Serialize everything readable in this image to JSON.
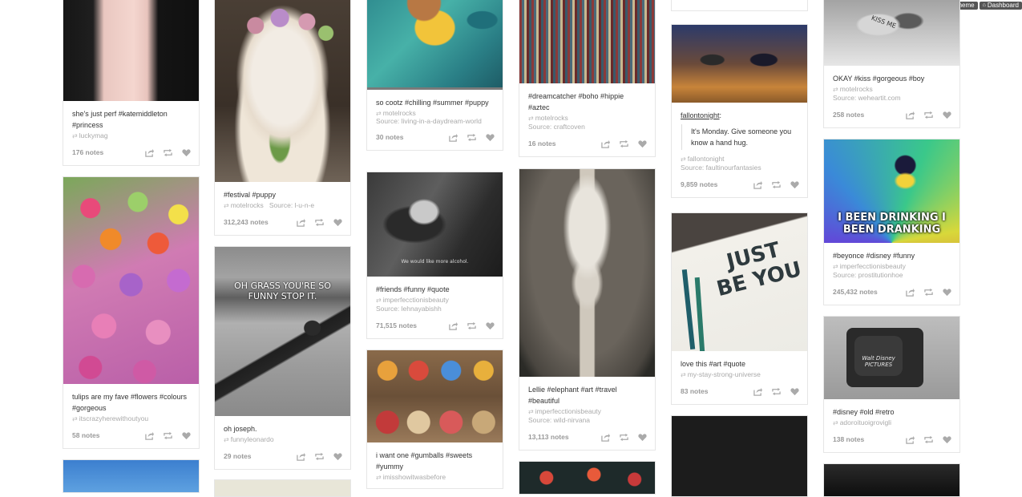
{
  "topbar": {
    "edit_label": "Edit theme",
    "dashboard_label": "Dashboard"
  },
  "colors": {
    "bg": "#ffffff",
    "card_border": "#e6e6e6",
    "muted": "#aaaaaa",
    "icon": "#aaaaaa"
  },
  "col1": {
    "p1": {
      "caption": "she's just perf #katemiddleton #princess",
      "reblog": "luckymag",
      "notes": "176 notes"
    },
    "p2": {
      "caption": "tulips are my fave #flowers #colours #gorgeous",
      "reblog": "itscrazyherewithoutyou",
      "notes": "58 notes"
    }
  },
  "col2": {
    "p1": {
      "caption": "#festival #puppy",
      "reblog": "motelrocks",
      "source": "Source: l-u-n-e",
      "notes": "312,243 notes"
    },
    "p2": {
      "overlay": "OH GRASS YOU'RE SO FUNNY STOP IT.",
      "caption": "oh joseph.",
      "reblog": "funnyleonardo",
      "notes": "29 notes"
    }
  },
  "col3": {
    "p1": {
      "caption": "so cootz #chilling #summer #puppy",
      "reblog": "motelrocks",
      "source": "Source: living-in-a-daydream-world",
      "notes": "30 notes"
    },
    "p2": {
      "overlay": "We would like more alcohol.",
      "caption": "#friends #funny #quote",
      "reblog": "imperfecctionisbeauty",
      "source": "Source: lehnayabishh",
      "notes": "71,515 notes"
    },
    "p3": {
      "caption": "i want one #gumballs #sweets #yummy",
      "reblog": "imisshowitwasbefore"
    }
  },
  "col4": {
    "p1": {
      "caption": "#dreamcatcher #boho #hippie #aztec",
      "reblog": "motelrocks",
      "source": "Source: craftcoven",
      "notes": "16 notes"
    },
    "p2": {
      "caption": "Lellie #elephant #art #travel #beautiful",
      "reblog": "imperfecctionisbeauty",
      "source": "Source: wild-nirvana",
      "notes": "13,113 notes"
    }
  },
  "col5": {
    "p1": {
      "author": "fallontonight",
      "quote": "It's Monday. Give someone you know a hand hug.",
      "reblog": "fallontonight",
      "source": "Source: faultinourfantasies",
      "notes": "9,859 notes"
    },
    "p2": {
      "art_text": "JUST BE YOU",
      "caption": "love this #art #quote",
      "reblog": "my-stay-strong-universe",
      "notes": "83 notes"
    }
  },
  "col6": {
    "p1": {
      "art_text": "KISS ME",
      "caption": "OKAY #kiss #gorgeous #boy",
      "reblog": "motelrocks",
      "source": "Source: weheartit.com",
      "notes": "258 notes"
    },
    "p2": {
      "overlay": "I BEEN DRINKING I BEEN DRANKING",
      "caption": "#beyonce #disney #funny",
      "reblog": "imperfecctionisbeauty",
      "source": "Source: prostitutionhoe",
      "notes": "245,432 notes"
    },
    "p3": {
      "art_text": "Walt Disney PICTURES",
      "caption": "#disney #old #retro",
      "reblog": "adoroituoigrovigli",
      "notes": "138 notes"
    }
  }
}
